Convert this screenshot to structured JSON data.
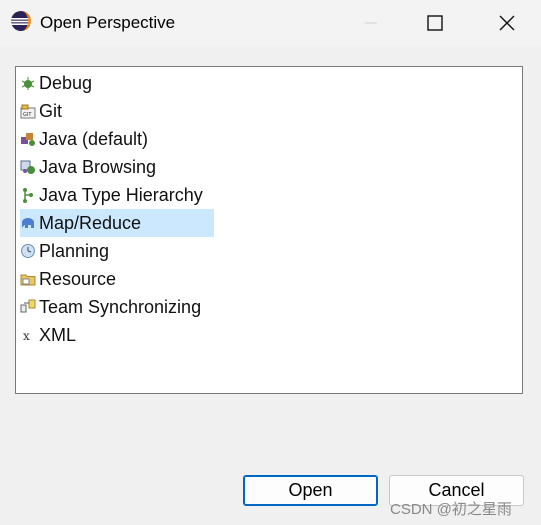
{
  "window": {
    "title": "Open Perspective"
  },
  "perspectives": [
    {
      "label": "Debug",
      "icon": "debug-icon"
    },
    {
      "label": "Git",
      "icon": "git-icon"
    },
    {
      "label": "Java (default)",
      "icon": "java-icon"
    },
    {
      "label": "Java Browsing",
      "icon": "java-browsing-icon"
    },
    {
      "label": "Java Type Hierarchy",
      "icon": "type-hierarchy-icon"
    },
    {
      "label": "Map/Reduce",
      "icon": "elephant-icon",
      "selected": true
    },
    {
      "label": "Planning",
      "icon": "clock-icon"
    },
    {
      "label": "Resource",
      "icon": "folder-icon"
    },
    {
      "label": "Team Synchronizing",
      "icon": "team-sync-icon"
    },
    {
      "label": "XML",
      "icon": "xml-icon"
    }
  ],
  "buttons": {
    "open_label": "Open",
    "cancel_label": "Cancel"
  },
  "watermark": "CSDN @初之星雨",
  "colors": {
    "selection": "#cce8ff",
    "default_button_border": "#0067c0"
  }
}
